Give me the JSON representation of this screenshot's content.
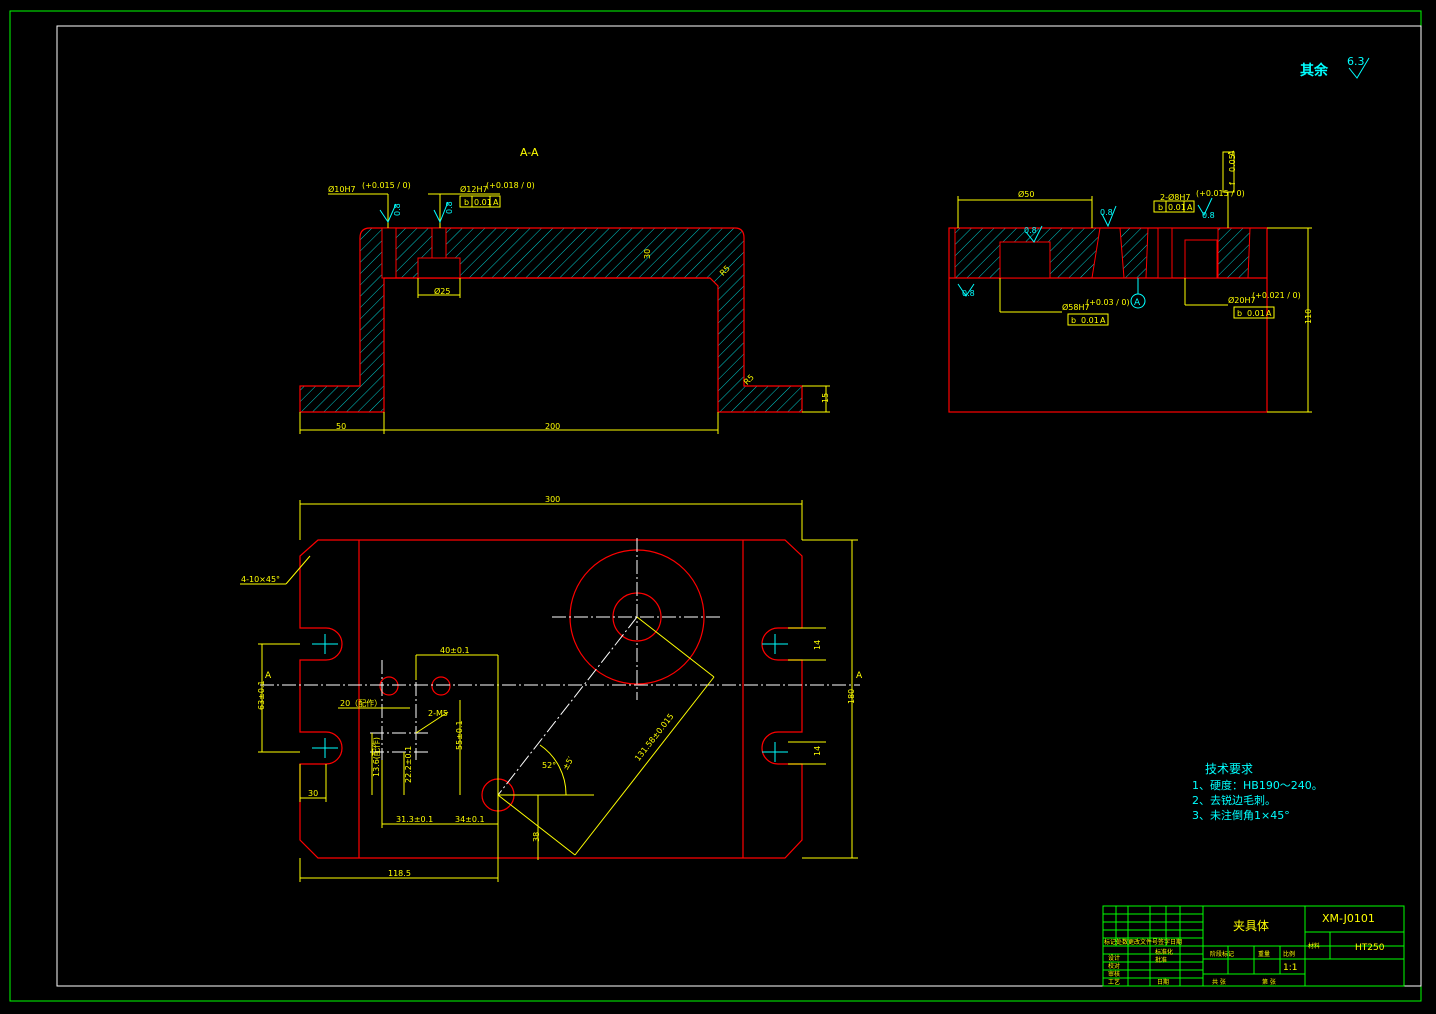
{
  "surface_note": {
    "label": "其余",
    "value": "6.3"
  },
  "section_title": "A-A",
  "section_view": {
    "dims": {
      "left_flange": "50",
      "span": "200",
      "height": "30",
      "foot": "15",
      "radius_r": "R5",
      "fillet": "R5",
      "bore": "Ø25"
    },
    "tol1": {
      "label": "Ø10H7",
      "tol": "(+0.015 / 0)"
    },
    "tol2": {
      "label": "Ø12H7",
      "tol": "(+0.018 / 0)",
      "frame_sym": "b",
      "frame_val": "0.01",
      "frame_ref": "A"
    },
    "rough": "0.8"
  },
  "side_view": {
    "dims": {
      "width": "Ø50",
      "height": "110",
      "tol3": "2-Ø8H7",
      "tol3_t": "(+0.015 / 0)",
      "tol4": "Ø58H7",
      "tol4_t": "(+0.03 / 0)",
      "tol5": "Ø20H7",
      "tol5_t": "(+0.021 / 0)"
    },
    "frame_sym": "b",
    "frame_val": "0.01",
    "frame_ref": "A",
    "runout_sym": "f",
    "runout_val": "0.05",
    "runout_ref": "A",
    "datum": "A",
    "rough": "0.8"
  },
  "plan_view": {
    "dims": {
      "overall": "300",
      "height": "180",
      "chamfer": "4-10×45°",
      "slot_w1": "14",
      "slot_w2": "14",
      "left_off": "30",
      "bottom": "118.5",
      "d1": "63±0.1",
      "d2": "40±0.1",
      "d3": "20（配作）",
      "d4": "2-M5",
      "d5": "55±0.1",
      "d6": "13.6(配作)",
      "d7": "22.2±0.1",
      "d8": "31.3±0.1",
      "d9": "34±0.1",
      "d10": "131.58±0.015",
      "d11": "52°",
      "d12": "±5′",
      "d13": "38"
    },
    "section_mark": "A"
  },
  "tech_req": {
    "title": "技术要求",
    "items": [
      "1、硬度：HB190～240。",
      "2、去锐边毛刺。",
      "3、未注倒角1×45°"
    ]
  },
  "title_block": {
    "part_name": "夹具体",
    "drawing_no": "XM-J0101",
    "material": "HT250",
    "scale": "1:1",
    "cells": {
      "r1": "标记处数更改文件号签字日期",
      "design": "设计",
      "standard": "标准化",
      "check": "审核",
      "approve": "批准",
      "process": "工艺",
      "date": "日期",
      "drawn": "校对",
      "stage": "阶段标记",
      "weight": "重量",
      "ratio": "比例",
      "sheets": "共   张",
      "sheet": "第   张",
      "mat_label": "材料"
    }
  }
}
